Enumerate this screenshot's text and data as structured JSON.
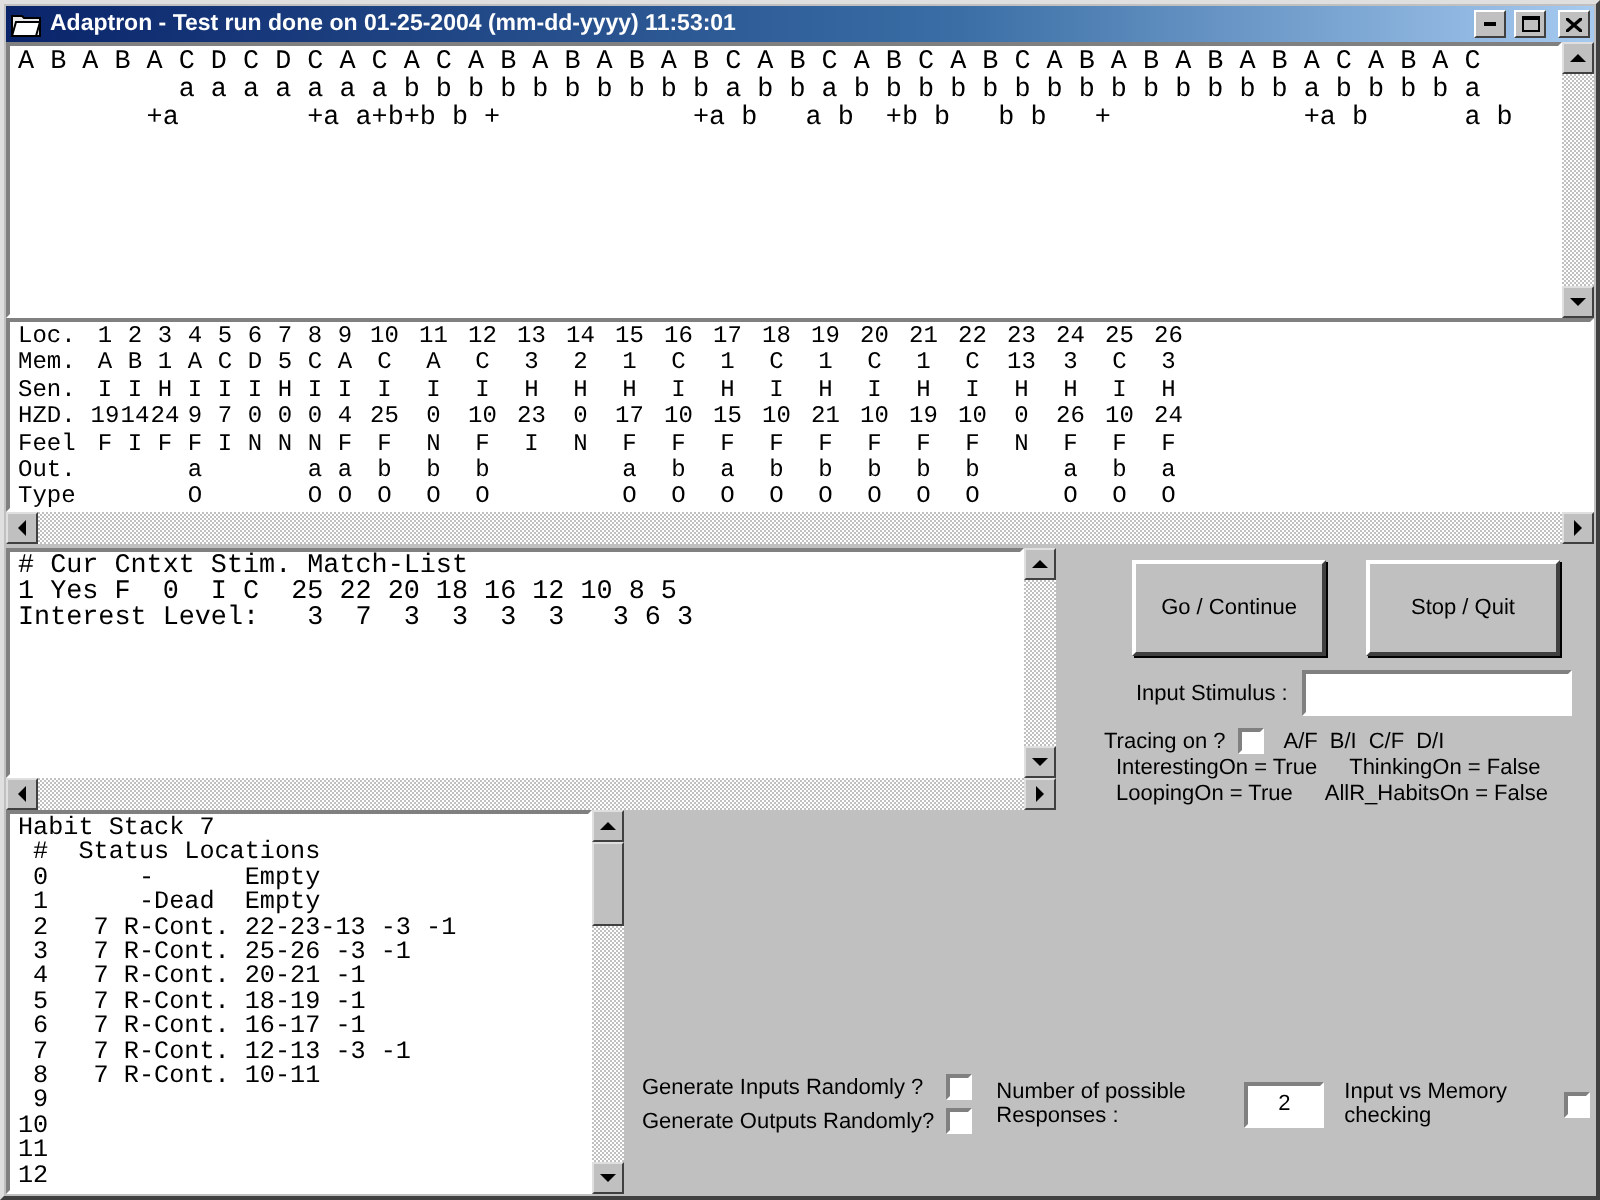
{
  "window": {
    "title": "Adaptron - Test run done on 01-25-2004 (mm-dd-yyyy) 11:53:01"
  },
  "sequence_box": {
    "lines": [
      "A B A B A C D C D C A C A C A B A B A B A B C A B C A B C A B C A B A B A B A B A C A B A C",
      "          a a a a a a a b b b b b b b b b b a b b a b b b b b b b b b b b b b b a b b b b a",
      "        +a        +a a+b+b b +            +a b   a b  +b b   b b   +            +a b      a b"
    ]
  },
  "memory_table": {
    "rows": [
      {
        "label": "Loc.",
        "cells": [
          "1",
          "2",
          "3",
          "4",
          "5",
          "6",
          "7",
          "8",
          "9",
          "10",
          "11",
          "12",
          "13",
          "14",
          "15",
          "16",
          "17",
          "18",
          "19",
          "20",
          "21",
          "22",
          "23",
          "24",
          "25",
          "26"
        ]
      },
      {
        "label": "Mem.",
        "cells": [
          "A",
          "B",
          "1",
          "A",
          "C",
          "D",
          "5",
          "C",
          "A",
          "C",
          "A",
          "C",
          "3",
          "2",
          "1",
          "C",
          "1",
          "C",
          "1",
          "C",
          "1",
          "C",
          "13",
          "3",
          "C",
          "3"
        ]
      },
      {
        "label": "Sen.",
        "cells": [
          "I",
          "I",
          "H",
          "I",
          "I",
          "I",
          "H",
          "I",
          "I",
          "I",
          "I",
          "I",
          "H",
          "H",
          "H",
          "I",
          "H",
          "I",
          "H",
          "I",
          "H",
          "I",
          "H",
          "H",
          "I",
          "H"
        ]
      },
      {
        "label": "HZD.",
        "cells": [
          "19",
          "14",
          "24",
          "9",
          "7",
          "0",
          "0",
          "0",
          "4",
          "25",
          "0",
          "10",
          "23",
          "0",
          "17",
          "10",
          "15",
          "10",
          "21",
          "10",
          "19",
          "10",
          "0",
          "26",
          "10",
          "24"
        ]
      },
      {
        "label": "Feel",
        "cells": [
          "F",
          "I",
          "F",
          "F",
          "I",
          "N",
          "N",
          "N",
          "F",
          "F",
          "N",
          "F",
          "I",
          "N",
          "F",
          "F",
          "F",
          "F",
          "F",
          "F",
          "F",
          "F",
          "N",
          "F",
          "F",
          "F"
        ]
      },
      {
        "label": "Out.",
        "cells": [
          null,
          null,
          null,
          "a",
          null,
          null,
          null,
          "a",
          "a",
          "b",
          "b",
          "b",
          null,
          null,
          "a",
          "b",
          "a",
          "b",
          "b",
          "b",
          "b",
          "b",
          null,
          "a",
          "b",
          "a"
        ]
      },
      {
        "label": "Type",
        "cells": [
          null,
          null,
          null,
          "O",
          null,
          null,
          null,
          "O",
          "O",
          "O",
          "O",
          "O",
          null,
          null,
          "O",
          "O",
          "O",
          "O",
          "O",
          "O",
          "O",
          "O",
          null,
          "O",
          "O",
          "O"
        ]
      }
    ]
  },
  "match_box": {
    "lines": [
      "# Cur Cntxt Stim. Match-List",
      "1 Yes F  0  I C  25 22 20 18 16 12 10 8 5",
      "Interest Level:   3  7  3  3  3  3   3 6 3"
    ]
  },
  "habit_stack": {
    "lines": [
      "Habit Stack 7",
      " #  Status Locations",
      " 0      -      Empty",
      " 1      -Dead  Empty",
      " 2   7 R-Cont. 22-23-13 -3 -1",
      " 3   7 R-Cont. 25-26 -3 -1",
      " 4   7 R-Cont. 20-21 -1",
      " 5   7 R-Cont. 18-19 -1",
      " 6   7 R-Cont. 16-17 -1",
      " 7   7 R-Cont. 12-13 -3 -1",
      " 8   7 R-Cont. 10-11",
      " 9",
      "10",
      "11",
      "12"
    ]
  },
  "buttons": [
    {
      "label": "Go / Continue"
    },
    {
      "label": "Stop / Quit"
    }
  ],
  "input_stimulus": {
    "label": "Input Stimulus :"
  },
  "tracing": {
    "label": "Tracing on ?",
    "checked": false,
    "options": [
      "A/F",
      "B/I",
      "C/F",
      "D/I"
    ]
  },
  "flags": [
    [
      "InterestingOn = True",
      "ThinkingOn = False"
    ],
    [
      "LoopingOn = True",
      "AllR_HabitsOn = False"
    ]
  ],
  "random_options": [
    {
      "label": "Generate Inputs Randomly ?",
      "checked": false
    },
    {
      "label": "Generate Outputs Randomly?",
      "checked": false
    }
  ],
  "responses": {
    "label": "Number of possible Responses :",
    "value": "2"
  },
  "memory_check": {
    "label": "Input vs Memory checking",
    "checked": false
  }
}
